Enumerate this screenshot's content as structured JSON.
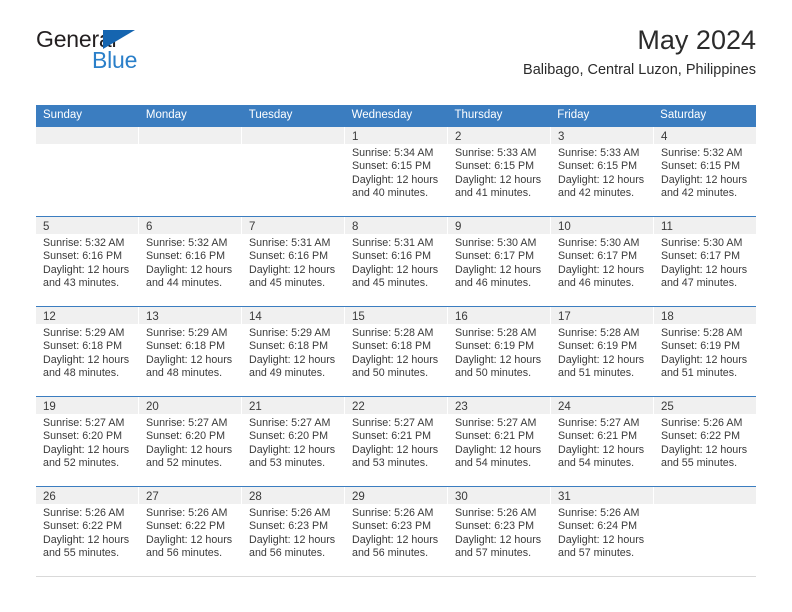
{
  "brand": {
    "word_one": "General",
    "word_two": "Blue",
    "triangle_icon": "triangle-icon",
    "accent_color": "#2a7fc9"
  },
  "header": {
    "title": "May 2024",
    "subtitle": "Balibago, Central Luzon, Philippines"
  },
  "calendar": {
    "header_color": "#3b7dc0",
    "day_names": [
      "Sunday",
      "Monday",
      "Tuesday",
      "Wednesday",
      "Thursday",
      "Friday",
      "Saturday"
    ],
    "weeks": [
      [
        {
          "empty": true
        },
        {
          "empty": true
        },
        {
          "empty": true
        },
        {
          "day": "1",
          "sunrise": "Sunrise: 5:34 AM",
          "sunset": "Sunset: 6:15 PM",
          "daylight1": "Daylight: 12 hours",
          "daylight2": "and 40 minutes."
        },
        {
          "day": "2",
          "sunrise": "Sunrise: 5:33 AM",
          "sunset": "Sunset: 6:15 PM",
          "daylight1": "Daylight: 12 hours",
          "daylight2": "and 41 minutes."
        },
        {
          "day": "3",
          "sunrise": "Sunrise: 5:33 AM",
          "sunset": "Sunset: 6:15 PM",
          "daylight1": "Daylight: 12 hours",
          "daylight2": "and 42 minutes."
        },
        {
          "day": "4",
          "sunrise": "Sunrise: 5:32 AM",
          "sunset": "Sunset: 6:15 PM",
          "daylight1": "Daylight: 12 hours",
          "daylight2": "and 42 minutes."
        }
      ],
      [
        {
          "day": "5",
          "sunrise": "Sunrise: 5:32 AM",
          "sunset": "Sunset: 6:16 PM",
          "daylight1": "Daylight: 12 hours",
          "daylight2": "and 43 minutes."
        },
        {
          "day": "6",
          "sunrise": "Sunrise: 5:32 AM",
          "sunset": "Sunset: 6:16 PM",
          "daylight1": "Daylight: 12 hours",
          "daylight2": "and 44 minutes."
        },
        {
          "day": "7",
          "sunrise": "Sunrise: 5:31 AM",
          "sunset": "Sunset: 6:16 PM",
          "daylight1": "Daylight: 12 hours",
          "daylight2": "and 45 minutes."
        },
        {
          "day": "8",
          "sunrise": "Sunrise: 5:31 AM",
          "sunset": "Sunset: 6:16 PM",
          "daylight1": "Daylight: 12 hours",
          "daylight2": "and 45 minutes."
        },
        {
          "day": "9",
          "sunrise": "Sunrise: 5:30 AM",
          "sunset": "Sunset: 6:17 PM",
          "daylight1": "Daylight: 12 hours",
          "daylight2": "and 46 minutes."
        },
        {
          "day": "10",
          "sunrise": "Sunrise: 5:30 AM",
          "sunset": "Sunset: 6:17 PM",
          "daylight1": "Daylight: 12 hours",
          "daylight2": "and 46 minutes."
        },
        {
          "day": "11",
          "sunrise": "Sunrise: 5:30 AM",
          "sunset": "Sunset: 6:17 PM",
          "daylight1": "Daylight: 12 hours",
          "daylight2": "and 47 minutes."
        }
      ],
      [
        {
          "day": "12",
          "sunrise": "Sunrise: 5:29 AM",
          "sunset": "Sunset: 6:18 PM",
          "daylight1": "Daylight: 12 hours",
          "daylight2": "and 48 minutes."
        },
        {
          "day": "13",
          "sunrise": "Sunrise: 5:29 AM",
          "sunset": "Sunset: 6:18 PM",
          "daylight1": "Daylight: 12 hours",
          "daylight2": "and 48 minutes."
        },
        {
          "day": "14",
          "sunrise": "Sunrise: 5:29 AM",
          "sunset": "Sunset: 6:18 PM",
          "daylight1": "Daylight: 12 hours",
          "daylight2": "and 49 minutes."
        },
        {
          "day": "15",
          "sunrise": "Sunrise: 5:28 AM",
          "sunset": "Sunset: 6:18 PM",
          "daylight1": "Daylight: 12 hours",
          "daylight2": "and 50 minutes."
        },
        {
          "day": "16",
          "sunrise": "Sunrise: 5:28 AM",
          "sunset": "Sunset: 6:19 PM",
          "daylight1": "Daylight: 12 hours",
          "daylight2": "and 50 minutes."
        },
        {
          "day": "17",
          "sunrise": "Sunrise: 5:28 AM",
          "sunset": "Sunset: 6:19 PM",
          "daylight1": "Daylight: 12 hours",
          "daylight2": "and 51 minutes."
        },
        {
          "day": "18",
          "sunrise": "Sunrise: 5:28 AM",
          "sunset": "Sunset: 6:19 PM",
          "daylight1": "Daylight: 12 hours",
          "daylight2": "and 51 minutes."
        }
      ],
      [
        {
          "day": "19",
          "sunrise": "Sunrise: 5:27 AM",
          "sunset": "Sunset: 6:20 PM",
          "daylight1": "Daylight: 12 hours",
          "daylight2": "and 52 minutes."
        },
        {
          "day": "20",
          "sunrise": "Sunrise: 5:27 AM",
          "sunset": "Sunset: 6:20 PM",
          "daylight1": "Daylight: 12 hours",
          "daylight2": "and 52 minutes."
        },
        {
          "day": "21",
          "sunrise": "Sunrise: 5:27 AM",
          "sunset": "Sunset: 6:20 PM",
          "daylight1": "Daylight: 12 hours",
          "daylight2": "and 53 minutes."
        },
        {
          "day": "22",
          "sunrise": "Sunrise: 5:27 AM",
          "sunset": "Sunset: 6:21 PM",
          "daylight1": "Daylight: 12 hours",
          "daylight2": "and 53 minutes."
        },
        {
          "day": "23",
          "sunrise": "Sunrise: 5:27 AM",
          "sunset": "Sunset: 6:21 PM",
          "daylight1": "Daylight: 12 hours",
          "daylight2": "and 54 minutes."
        },
        {
          "day": "24",
          "sunrise": "Sunrise: 5:27 AM",
          "sunset": "Sunset: 6:21 PM",
          "daylight1": "Daylight: 12 hours",
          "daylight2": "and 54 minutes."
        },
        {
          "day": "25",
          "sunrise": "Sunrise: 5:26 AM",
          "sunset": "Sunset: 6:22 PM",
          "daylight1": "Daylight: 12 hours",
          "daylight2": "and 55 minutes."
        }
      ],
      [
        {
          "day": "26",
          "sunrise": "Sunrise: 5:26 AM",
          "sunset": "Sunset: 6:22 PM",
          "daylight1": "Daylight: 12 hours",
          "daylight2": "and 55 minutes."
        },
        {
          "day": "27",
          "sunrise": "Sunrise: 5:26 AM",
          "sunset": "Sunset: 6:22 PM",
          "daylight1": "Daylight: 12 hours",
          "daylight2": "and 56 minutes."
        },
        {
          "day": "28",
          "sunrise": "Sunrise: 5:26 AM",
          "sunset": "Sunset: 6:23 PM",
          "daylight1": "Daylight: 12 hours",
          "daylight2": "and 56 minutes."
        },
        {
          "day": "29",
          "sunrise": "Sunrise: 5:26 AM",
          "sunset": "Sunset: 6:23 PM",
          "daylight1": "Daylight: 12 hours",
          "daylight2": "and 56 minutes."
        },
        {
          "day": "30",
          "sunrise": "Sunrise: 5:26 AM",
          "sunset": "Sunset: 6:23 PM",
          "daylight1": "Daylight: 12 hours",
          "daylight2": "and 57 minutes."
        },
        {
          "day": "31",
          "sunrise": "Sunrise: 5:26 AM",
          "sunset": "Sunset: 6:24 PM",
          "daylight1": "Daylight: 12 hours",
          "daylight2": "and 57 minutes."
        },
        {
          "empty": true
        }
      ]
    ]
  }
}
